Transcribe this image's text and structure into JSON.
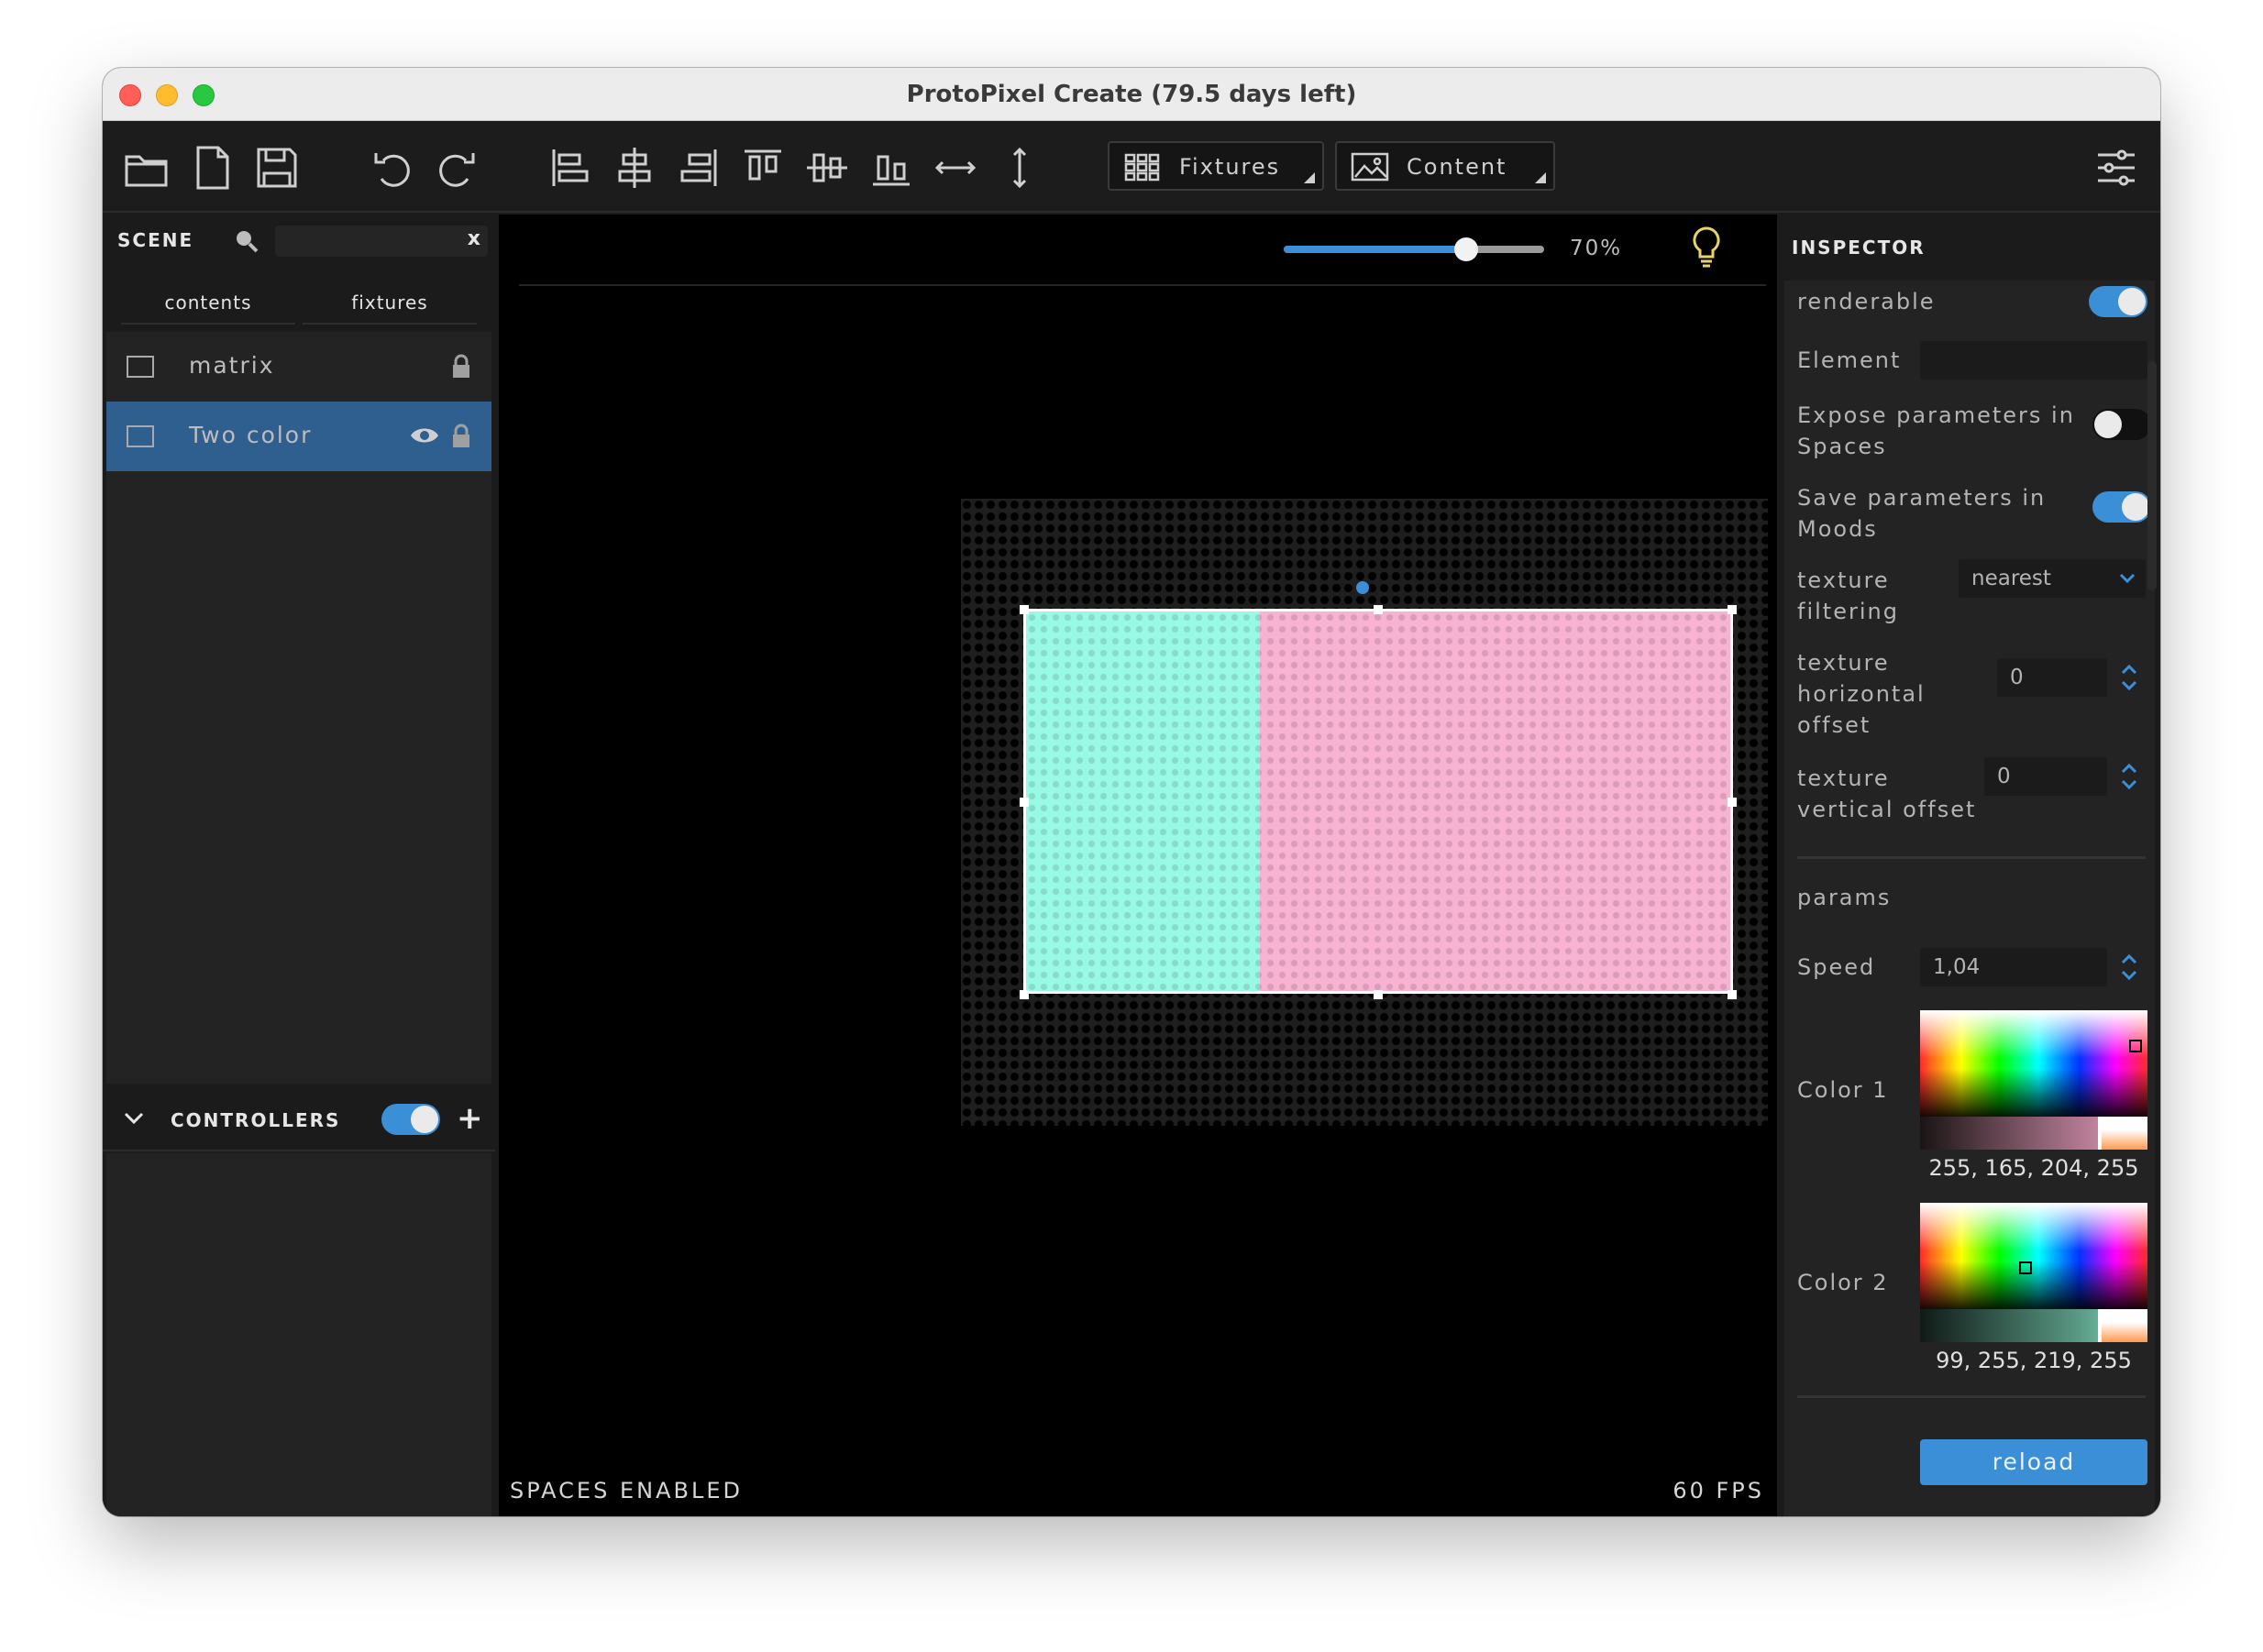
{
  "window": {
    "title": "ProtoPixel Create (79.5 days left)",
    "traffic_lights": {
      "close": "#ff5f57",
      "minimize": "#febc2e",
      "zoom": "#28c840"
    }
  },
  "toolbar": {
    "icons": [
      "open-folder-icon",
      "new-file-icon",
      "save-icon",
      "undo-icon",
      "redo-icon",
      "align-left-icon",
      "align-center-h-icon",
      "align-right-icon",
      "align-top-icon",
      "align-middle-v-icon",
      "align-bottom-icon",
      "distribute-h-icon",
      "distribute-v-icon",
      "settings-sliders-icon"
    ],
    "fixtures_label": "Fixtures",
    "content_label": "Content"
  },
  "scene": {
    "label": "SCENE",
    "search_value": "",
    "clear_label": "x",
    "tabs": [
      {
        "label": "contents"
      },
      {
        "label": "fixtures"
      }
    ],
    "items": [
      {
        "label": "matrix",
        "selected": false
      },
      {
        "label": "Two color",
        "selected": true
      }
    ]
  },
  "controllers": {
    "label": "CONTROLLERS",
    "enabled": true,
    "add_label": "+"
  },
  "viewport": {
    "zoom_label": "70%",
    "zoom_percent": 70,
    "status_left": "SPACES ENABLED",
    "status_right": "60 FPS",
    "content_colors": {
      "left": "#98f9e5",
      "right": "#f8b2d2"
    },
    "accent": "#3b8fd6"
  },
  "inspector": {
    "label": "INSPECTOR",
    "renderable": {
      "label": "renderable",
      "on": true
    },
    "element": {
      "label": "Element",
      "value": ""
    },
    "expose": {
      "label_1": "Expose parameters in",
      "label_2": "Spaces",
      "on": false
    },
    "save": {
      "label_1": "Save parameters in",
      "label_2": "Moods",
      "on": true
    },
    "texture_filtering": {
      "label_1": "texture",
      "label_2": "filtering",
      "value": "nearest"
    },
    "h_offset": {
      "label_1": "texture",
      "label_2": "horizontal",
      "label_3": "offset",
      "value": "0"
    },
    "v_offset": {
      "label_1": "texture",
      "label_2": "vertical offset",
      "value": "0"
    },
    "params_label": "params",
    "speed": {
      "label": "Speed",
      "value": "1,04"
    },
    "color1": {
      "label": "Color 1",
      "rgba": "255, 165, 204, 255",
      "hex": "#ffa5cc"
    },
    "color2": {
      "label": "Color 2",
      "rgba": "99, 255, 219, 255",
      "hex": "#63ffdb"
    },
    "reload_label": "reload"
  }
}
